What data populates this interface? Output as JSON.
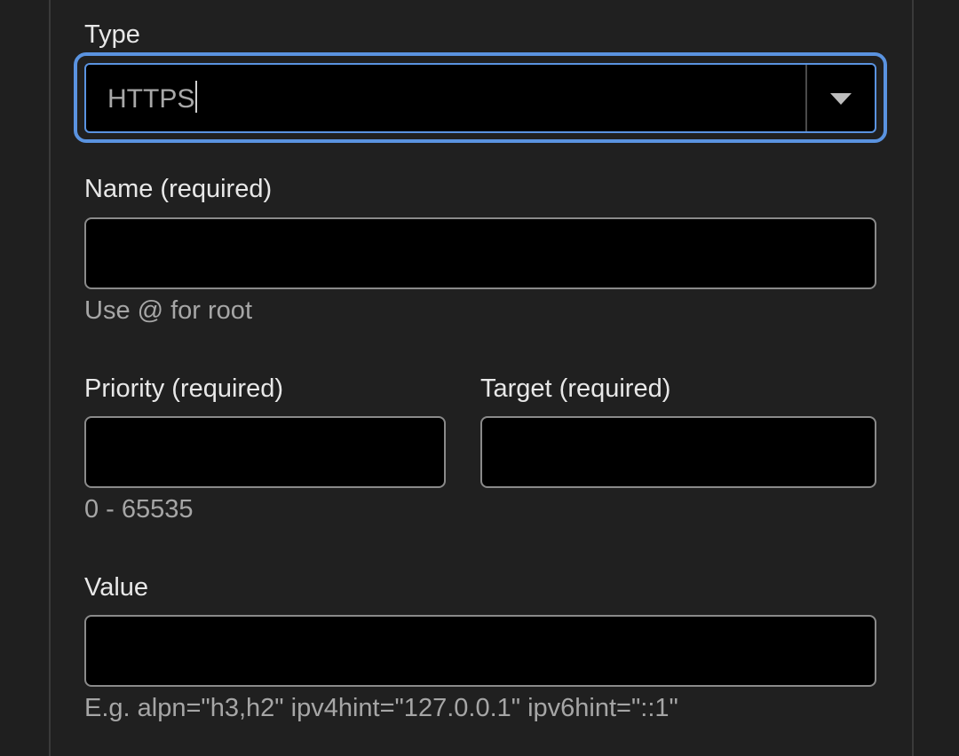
{
  "form": {
    "type": {
      "label": "Type",
      "selected_value": "HTTPS"
    },
    "name": {
      "label": "Name (required)",
      "value": "",
      "hint": "Use @ for root"
    },
    "priority": {
      "label": "Priority (required)",
      "value": "",
      "hint": "0 - 65535"
    },
    "target": {
      "label": "Target (required)",
      "value": ""
    },
    "value": {
      "label": "Value",
      "value": "",
      "hint": "E.g. alpn=\"h3,h2\" ipv4hint=\"127.0.0.1\" ipv6hint=\"::1\""
    }
  },
  "icons": {
    "type_dropdown": "chevron-down-icon"
  },
  "colors": {
    "background": "#1f1f1f",
    "field_background": "#000000",
    "field_border": "#8a8a8a",
    "focus_ring": "#5a93e0",
    "label_text": "#e8e8e8",
    "hint_text": "#a6a6a6"
  }
}
